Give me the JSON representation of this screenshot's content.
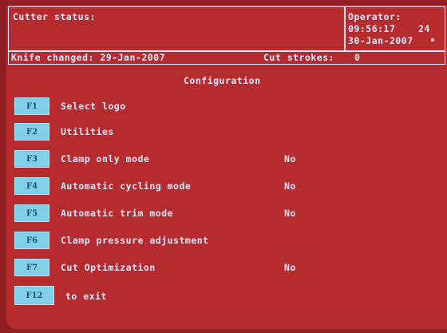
{
  "header": {
    "cutter_status_label": "Cutter status:",
    "operator_label": "Operator:",
    "time": "09:56:17",
    "time_extra": "24",
    "date": "30-Jan-2007",
    "knife_changed": "Knife changed: 29-Jan-2007",
    "cut_strokes_label": "Cut strokes:",
    "cut_strokes_value": "0"
  },
  "title": "Configuration",
  "menu": [
    {
      "key": "F1",
      "label": "Select logo",
      "value": ""
    },
    {
      "key": "F2",
      "label": "Utilities",
      "value": ""
    },
    {
      "key": "F3",
      "label": "Clamp only mode",
      "value": "No"
    },
    {
      "key": "F4",
      "label": "Automatic cycling mode",
      "value": "No"
    },
    {
      "key": "F5",
      "label": "Automatic trim mode",
      "value": "No"
    },
    {
      "key": "F6",
      "label": "Clamp pressure adjustment",
      "value": ""
    },
    {
      "key": "F7",
      "label": "Cut Optimization",
      "value": "No"
    }
  ],
  "exit": {
    "key": "F12",
    "label": "to exit"
  }
}
